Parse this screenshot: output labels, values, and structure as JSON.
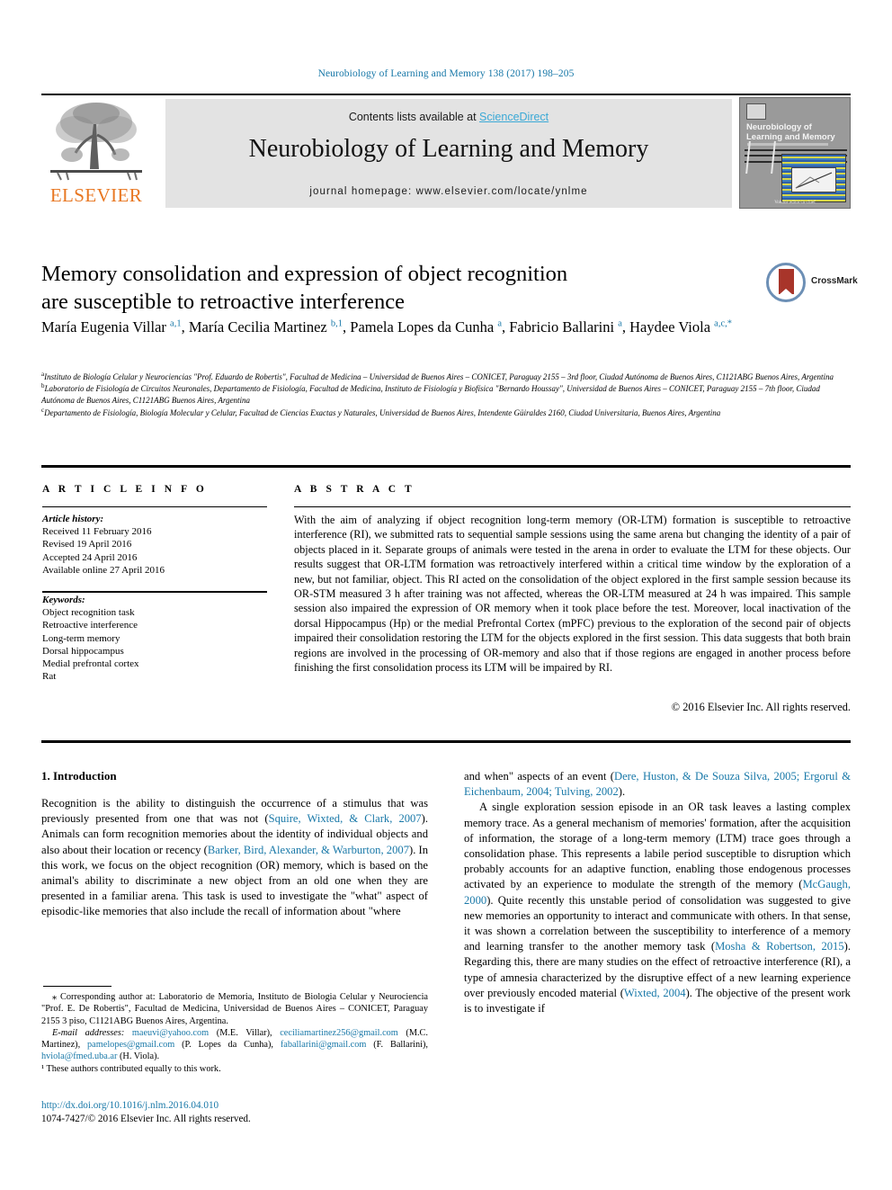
{
  "running_head": "Neurobiology of Learning and Memory 138 (2017) 198–205",
  "masthead": {
    "publisher": "ELSEVIER",
    "contents_prefix": "Contents lists available at ",
    "contents_link": "ScienceDirect",
    "journal_title": "Neurobiology of Learning and Memory",
    "homepage": "journal homepage: www.elsevier.com/locate/ynlme",
    "cover_title": "Neurobiology of Learning and Memory",
    "cover_footer": "Volume editor-in-chief"
  },
  "crossmark": {
    "label": "CrossMark"
  },
  "title_line1": "Memory consolidation and expression of object recognition",
  "title_line2": "are susceptible to retroactive interference",
  "authors": [
    {
      "name": "María Eugenia Villar",
      "sup": "a,1",
      "sep": ", "
    },
    {
      "name": "María Cecilia Martinez",
      "sup": "b,1",
      "sep": ", "
    },
    {
      "name": "Pamela Lopes da Cunha",
      "sup": "a",
      "sep": ", "
    },
    {
      "name": "Fabricio Ballarini",
      "sup": "a",
      "sep": ", "
    },
    {
      "name": "Haydee Viola",
      "sup": "a,c,*",
      "sep": ""
    }
  ],
  "affiliations": [
    {
      "mark": "a",
      "text": "Instituto de Biología Celular y Neurociencias \"Prof. Eduardo de Robertis\", Facultad de Medicina – Universidad de Buenos Aires – CONICET, Paraguay 2155 – 3rd floor, Ciudad Autónoma de Buenos Aires, C1121ABG Buenos Aires, Argentina"
    },
    {
      "mark": "b",
      "text": "Laboratorio de Fisiología de Circuitos Neuronales, Departamento de Fisiología, Facultad de Medicina, Instituto de Fisiología y Biofísica \"Bernardo Houssay\", Universidad de Buenos Aires – CONICET, Paraguay 2155 – 7th floor, Ciudad Autónoma de Buenos Aires, C1121ABG Buenos Aires, Argentina"
    },
    {
      "mark": "c",
      "text": "Departamento de Fisiología, Biología Molecular y Celular, Facultad de Ciencias Exactas y Naturales, Universidad de Buenos Aires, Intendente Güiraldes 2160, Ciudad Universitaria, Buenos Aires, Argentina"
    }
  ],
  "article_info": {
    "heading": "A R T I C L E  I N F O",
    "history_label": "Article history:",
    "history": [
      "Received 11 February 2016",
      "Revised 19 April 2016",
      "Accepted 24 April 2016",
      "Available online 27 April 2016"
    ],
    "keywords_label": "Keywords:",
    "keywords": [
      "Object recognition task",
      "Retroactive interference",
      "Long-term memory",
      "Dorsal hippocampus",
      "Medial prefrontal cortex",
      "Rat"
    ]
  },
  "abstract": {
    "heading": "A B S T R A C T",
    "text": "With the aim of analyzing if object recognition long-term memory (OR-LTM) formation is susceptible to retroactive interference (RI), we submitted rats to sequential sample sessions using the same arena but changing the identity of a pair of objects placed in it. Separate groups of animals were tested in the arena in order to evaluate the LTM for these objects. Our results suggest that OR-LTM formation was retroactively interfered within a critical time window by the exploration of a new, but not familiar, object. This RI acted on the consolidation of the object explored in the first sample session because its OR-STM measured 3 h after training was not affected, whereas the OR-LTM measured at 24 h was impaired. This sample session also impaired the expression of OR memory when it took place before the test. Moreover, local inactivation of the dorsal Hippocampus (Hp) or the medial Prefrontal Cortex (mPFC) previous to the exploration of the second pair of objects impaired their consolidation restoring the LTM for the objects explored in the first session. This data suggests that both brain regions are involved in the processing of OR-memory and also that if those regions are engaged in another process before finishing the first consolidation process its LTM will be impaired by RI.",
    "copyright": "© 2016 Elsevier Inc. All rights reserved."
  },
  "body": {
    "section_number_title": "1. Introduction",
    "left_paragraph_parts": {
      "p1_a": "Recognition is the ability to distinguish the occurrence of a stimulus that was previously presented from one that was not (",
      "p1_ref1": "Squire, Wixted, & Clark, 2007",
      "p1_b": "). Animals can form recognition memories about the identity of individual objects and also about their location or recency (",
      "p1_ref2": "Barker, Bird, Alexander, & Warburton, 2007",
      "p1_c": "). In this work, we focus on the object recognition (OR) memory, which is based on the animal's ability to discriminate a new object from an old one when they are presented in a familiar arena. This task is used to investigate the \"what\" aspect of episodic-like memories that also include the recall of information about \"where"
    },
    "right_paragraph_parts": {
      "p0_a": "and when\" aspects of an event (",
      "p0_ref1": "Dere, Huston, & De Souza Silva, 2005; Ergorul & Eichenbaum, 2004; Tulving, 2002",
      "p0_b": ").",
      "p1_a": "A single exploration session episode in an OR task leaves a lasting complex memory trace. As a general mechanism of memories' formation, after the acquisition of information, the storage of a long-term memory (LTM) trace goes through a consolidation phase. This represents a labile period susceptible to disruption which probably accounts for an adaptive function, enabling those endogenous processes activated by an experience to modulate the strength of the memory (",
      "p1_ref1": "McGaugh, 2000",
      "p1_b": "). Quite recently this unstable period of consolidation was suggested to give new memories an opportunity to interact and communicate with others. In that sense, it was shown a correlation between the susceptibility to interference of a memory and learning transfer to the another memory task (",
      "p1_ref2": "Mosha & Robertson, 2015",
      "p1_c": "). Regarding this, there are many studies on the effect of retroactive interference (RI), a type of amnesia characterized by the disruptive effect of a new learning experience over previously encoded material (",
      "p1_ref3": "Wixted, 2004",
      "p1_d": "). The objective of the present work is to investigate if"
    }
  },
  "footnotes": {
    "corresponding": "⁎ Corresponding author at: Laboratorio de Memoria, Instituto de Biologia Celular y Neurociencia \"Prof. E. De Robertis\", Facultad de Medicina, Universidad de Buenos Aires – CONICET, Paraguay 2155 3 piso, C1121ABG Buenos Aires, Argentina.",
    "email_label": "E-mail addresses:",
    "emails": [
      {
        "address": "maeuvi@yahoo.com",
        "owner": " (M.E. Villar), "
      },
      {
        "address": "ceciliamartinez256@gmail.com",
        "owner": " (M.C. Martinez), "
      },
      {
        "address": "pamelopes@gmail.com",
        "owner": " (P. Lopes da Cunha), "
      },
      {
        "address": "faballarini@gmail.com",
        "owner": " (F. Ballarini), "
      },
      {
        "address": "hviola@fmed.uba.ar",
        "owner": " (H. Viola)."
      }
    ],
    "equal_contribution": "¹  These authors contributed equally to this work."
  },
  "footer": {
    "doi": "http://dx.doi.org/10.1016/j.nlm.2016.04.010",
    "issn_line": "1074-7427/© 2016 Elsevier Inc. All rights reserved."
  },
  "colors": {
    "link": "#1878a8",
    "sciencedirect": "#3ba9d6",
    "elsevier_orange": "#e87722",
    "banner_bg": "#e3e3e3"
  }
}
